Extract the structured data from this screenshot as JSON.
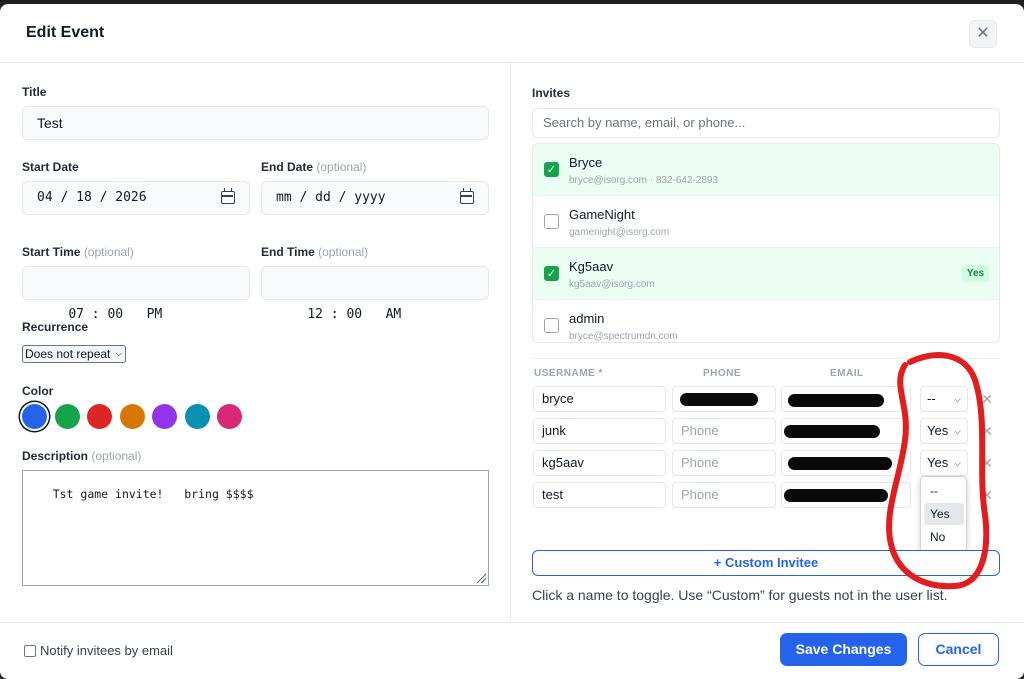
{
  "modal": {
    "title": "Edit Event",
    "close_label": "✕"
  },
  "form": {
    "title_label": "Title",
    "title_value": "Test",
    "start_date_label": "Start Date",
    "start_date_value": "04 / 18 / 2026",
    "end_date_label": "End Date",
    "end_date_value": "mm / dd / yyyy",
    "start_time_label": "Start Time",
    "start_time_value": "07 : 00   PM",
    "end_time_label": "End Time",
    "end_time_value": "12 : 00   AM",
    "optional_text": "(optional)",
    "recurrence_label": "Recurrence",
    "recurrence_value": "Does not repeat",
    "color_label": "Color",
    "colors": [
      "#2563eb",
      "#16a34a",
      "#dc2626",
      "#d97706",
      "#9333ea",
      "#0891b2",
      "#db2777"
    ],
    "description_label": "Description",
    "description_value": "Tst game invite!   bring $$$$"
  },
  "invites": {
    "label": "Invites",
    "search_placeholder": "Search by name, email, or phone...",
    "list": [
      {
        "name": "Bryce",
        "sub": "bryce@isorg.com · 832-642-2893",
        "checked": true
      },
      {
        "name": "GameNight",
        "sub": "gamenight@isorg.com",
        "checked": false
      },
      {
        "name": "Kg5aav",
        "sub": "kg5aav@isorg.com",
        "checked": true,
        "badge": "Yes"
      },
      {
        "name": "admin",
        "sub": "bryce@spectrumdn.com",
        "checked": false
      }
    ],
    "table_headers": {
      "username": "USERNAME *",
      "phone": "PHONE",
      "email": "EMAIL"
    },
    "rows": [
      {
        "username": "bryce",
        "phone": "",
        "rsvp": "--"
      },
      {
        "username": "junk",
        "phone": "Phone",
        "rsvp": "Yes"
      },
      {
        "username": "kg5aav",
        "phone": "Phone",
        "rsvp": "Yes"
      },
      {
        "username": "test",
        "phone": "Phone",
        "rsvp": ""
      }
    ],
    "rsvp_options": [
      "--",
      "Yes",
      "No"
    ],
    "custom_button": "+ Custom Invitee",
    "hint": "Click a name to toggle. Use “Custom” for guests not in the user list."
  },
  "footer": {
    "notify_label": "Notify invitees by email",
    "save_label": "Save Changes",
    "cancel_label": "Cancel"
  },
  "annotation": {
    "color": "#e11d1d"
  },
  "icons": {
    "calendar": "calendar-icon",
    "close": "close-icon",
    "remove": "remove-icon",
    "chevron": "chevron-down-icon"
  }
}
